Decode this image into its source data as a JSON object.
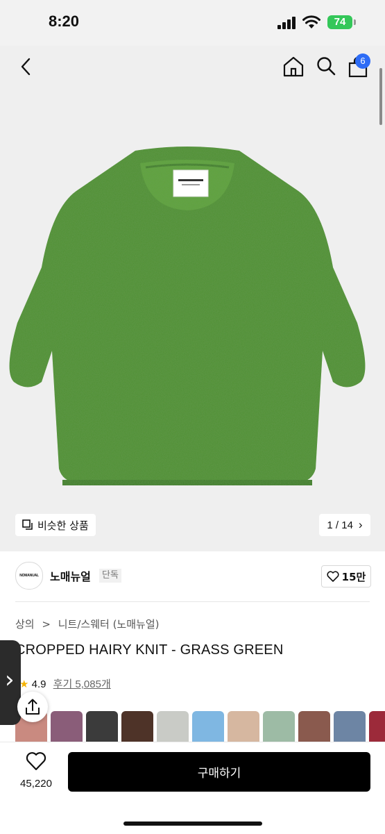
{
  "status": {
    "time": "8:20",
    "battery": "74"
  },
  "nav": {
    "cart_count": "6"
  },
  "gallery": {
    "similar_label": "비슷한 상품",
    "page_indicator": "1 / 14",
    "page_arrow": "›"
  },
  "brand": {
    "logo_text": "NOMANUAL",
    "name": "노매뉴얼",
    "badge": "단독",
    "likes": "15만"
  },
  "breadcrumb": {
    "category": "상의",
    "separator": ">",
    "subcategory": "니트/스웨터 (노매뉴얼)"
  },
  "product": {
    "title": "CROPPED HAIRY KNIT - GRASS GREEN",
    "rating": "4.9",
    "reviews": "후기 5,085개"
  },
  "side_tab": {
    "arrow": "›"
  },
  "swatch_colors": [
    "#c98a80",
    "#8a5d79",
    "#3b3b3b",
    "#4e3328",
    "#c9cbc6",
    "#7fb7e2",
    "#d6b7a0",
    "#9dbba5",
    "#8a5a4e",
    "#6d85a4",
    "#9c2a3a"
  ],
  "bottom": {
    "wish_count": "45,220",
    "buy_label": "구매하기"
  },
  "colors": {
    "accent": "#2d6cf6",
    "sweater": "#4f8f32",
    "battery": "#34c759"
  }
}
